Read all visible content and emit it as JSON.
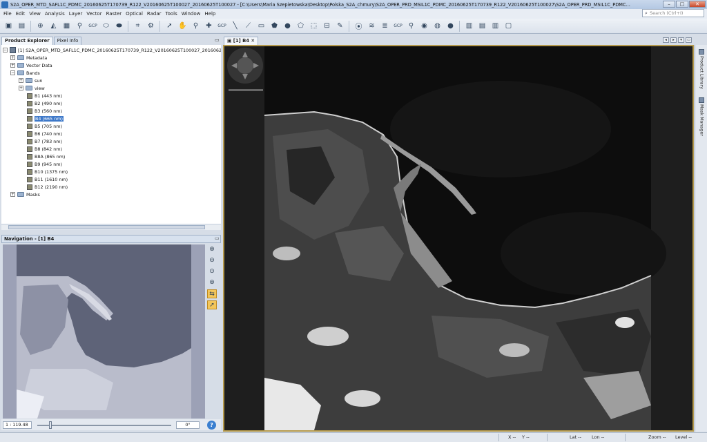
{
  "window": {
    "title": "S2A_OPER_MTD_SAFL1C_PDMC_20160625T170739_R122_V20160625T100027_20160625T100027 - [C:\\Users\\Maria Szepietowska\\Desktop\\Polska_S2A_chmury\\S2A_OPER_PRD_MSIL1C_PDMC_20160625T170739_R122_V20160625T100027\\S2A_OPER_PRD_MSIL1C_PDMC...",
    "minimize": "–",
    "maximize": "□",
    "close": "✕"
  },
  "menubar": [
    "File",
    "Edit",
    "View",
    "Analysis",
    "Layer",
    "Vector",
    "Raster",
    "Optical",
    "Radar",
    "Tools",
    "Window",
    "Help"
  ],
  "search": {
    "placeholder": "Search (Ctrl+I)"
  },
  "toolbar": {
    "icons": [
      "new-product-icon",
      "open-product-icon",
      "band-maths-icon",
      "spectrum-icon",
      "histogram-icon",
      "pin-icon",
      "gcp-icon",
      "mask-icon",
      "graph-builder-icon",
      "batch-icon",
      "select-tool-icon",
      "pan-tool-icon",
      "zoom-tool-icon",
      "pin-tool-icon",
      "gcp-tool-icon",
      "line-tool-icon",
      "polyline-tool-icon",
      "rectangle-tool-icon",
      "ellipse-tool-icon",
      "polygon-tool-icon",
      "magic-wand-icon",
      "range-finder-icon",
      "pixel-info-icon",
      "statistics-icon",
      "layer-manager-icon",
      "gcp-manager-icon",
      "world-view-icon",
      "eye-icon",
      "world-map-icon",
      "globe-icon",
      "tile-even-icon",
      "tile-horizontal-icon",
      "tile-vertical-icon",
      "tile-single-icon"
    ],
    "gcp_label": "GCP"
  },
  "product_explorer": {
    "tab_label": "Product Explorer",
    "pixel_info_tab": "Pixel Info",
    "root": "[1] S2A_OPER_MTD_SAFL1C_PDMC_20160625T170739_R122_V20160625T100027_20160625T100027_20160625T...",
    "metadata": "Metadata",
    "vector_data": "Vector Data",
    "bands": "Bands",
    "sun": "sun",
    "view": "view",
    "band_items": [
      "B1 (443 nm)",
      "B2 (490 nm)",
      "B3 (560 nm)",
      "B4 (665 nm)",
      "B5 (705 nm)",
      "B6 (740 nm)",
      "B7 (783 nm)",
      "B8 (842 nm)",
      "B8A (865 nm)",
      "B9 (945 nm)",
      "B10 (1375 nm)",
      "B11 (1610 nm)",
      "B12 (2190 nm)"
    ],
    "selected_band": "B4 (665 nm)",
    "masks": "Masks"
  },
  "navigation": {
    "title": "Navigation - [1] B4",
    "scale": "1 : 119.48",
    "angle": "0°",
    "help": "?"
  },
  "image_view": {
    "tab_label": "[1] B4"
  },
  "right_tools": {
    "product_library": "Product Library",
    "mask_manager": "Mask Manager"
  },
  "status": {
    "x": "X",
    "x_val": "--",
    "y": "Y",
    "y_val": "--",
    "lat": "Lat",
    "lat_val": "--",
    "lon": "Lon",
    "lon_val": "--",
    "zoom": "Zoom",
    "zoom_val": "--",
    "level": "Level",
    "level_val": "--"
  }
}
